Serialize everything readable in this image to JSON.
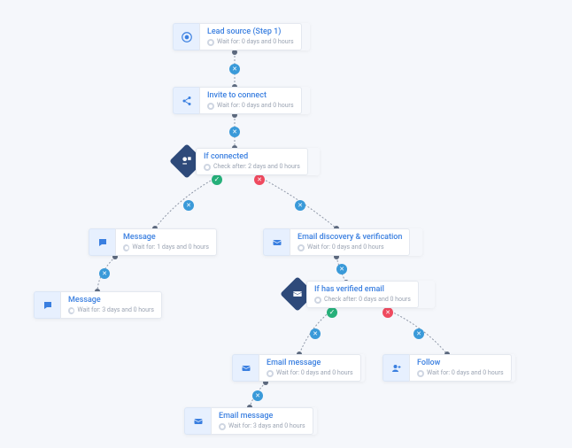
{
  "nodes": {
    "leadSource": {
      "title": "Lead source (Step 1)",
      "sub": "Wait for: 0 days and 0 hours",
      "icon": "target-icon"
    },
    "invite": {
      "title": "Invite to connect",
      "sub": "Wait for: 0 days and 0 hours",
      "icon": "share-icon"
    },
    "ifConnected": {
      "title": "If connected",
      "sub": "Check after: 2 days and 0 hours",
      "icon": "person-chat-icon"
    },
    "message1": {
      "title": "Message",
      "sub": "Wait for: 1 days and 0 hours",
      "icon": "chat-icon"
    },
    "message2": {
      "title": "Message",
      "sub": "Wait for: 3 days and 0 hours",
      "icon": "chat-icon"
    },
    "emailDiscovery": {
      "title": "Email discovery & verification",
      "sub": "Wait for: 0 days and 0 hours",
      "icon": "mail-search-icon"
    },
    "ifVerified": {
      "title": "If has verified email",
      "sub": "Check after: 0 days and 0 hours",
      "icon": "mail-shield-icon"
    },
    "emailMsg1": {
      "title": "Email message",
      "sub": "Wait for: 0 days and 0 hours",
      "icon": "mail-icon"
    },
    "emailMsg2": {
      "title": "Email message",
      "sub": "Wait for: 3 days and 0 hours",
      "icon": "mail-icon"
    },
    "follow": {
      "title": "Follow",
      "sub": "Wait for: 0 days and 0 hours",
      "icon": "person-plus-icon"
    }
  }
}
